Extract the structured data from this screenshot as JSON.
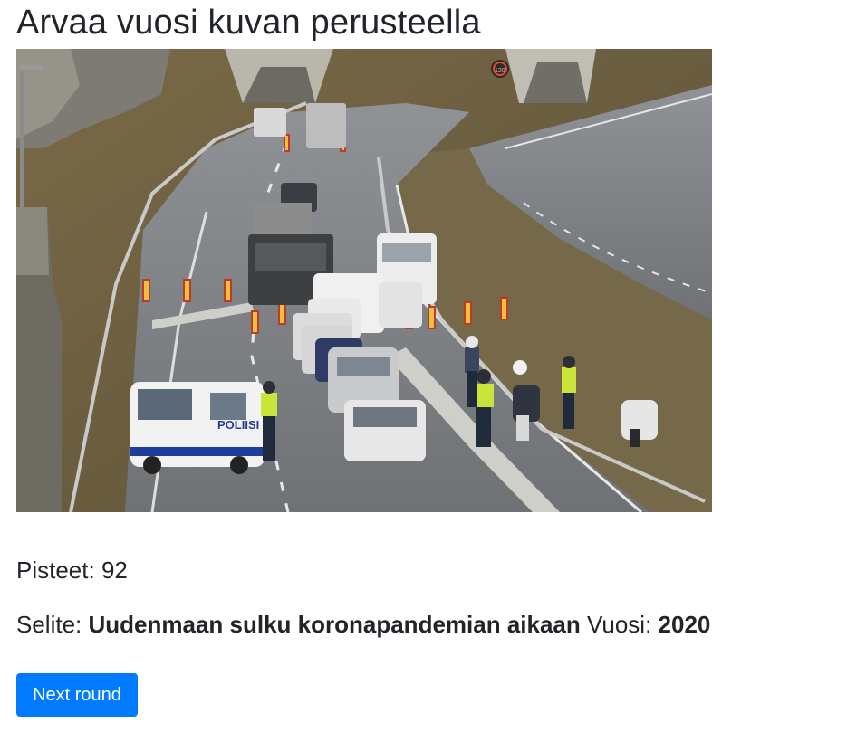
{
  "page": {
    "title": "Arvaa vuosi kuvan perusteella"
  },
  "photo": {
    "description_icon": "highway-police-checkpoint-photo",
    "police_van_text": "POLIISI",
    "speed_sign": "120"
  },
  "result": {
    "score_label": "Pisteet:",
    "score_value": "92",
    "caption_label": "Selite:",
    "caption_text": "Uudenmaan sulku koronapandemian aikaan",
    "year_label": "Vuosi:",
    "year_value": "2020"
  },
  "actions": {
    "next_label": "Next round"
  },
  "colors": {
    "button": "#007bff",
    "text": "#212529"
  }
}
